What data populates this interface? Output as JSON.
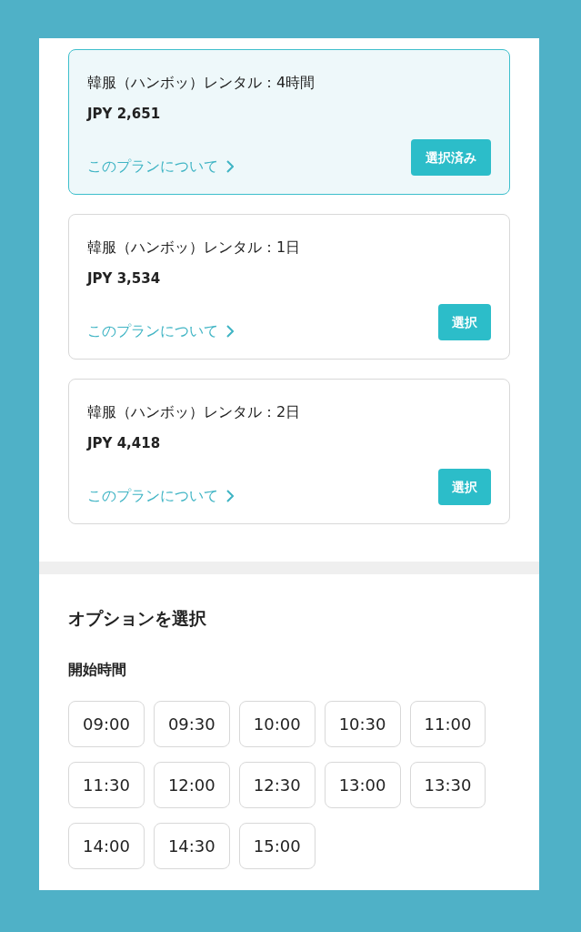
{
  "plans": [
    {
      "title": "韓服（ハンボッ）レンタル：4時間",
      "price": "JPY 2,651",
      "link": "このプランについて",
      "button": "選択済み",
      "selected": true
    },
    {
      "title": "韓服（ハンボッ）レンタル：1日",
      "price": "JPY 3,534",
      "link": "このプランについて",
      "button": "選択",
      "selected": false
    },
    {
      "title": "韓服（ハンボッ）レンタル：2日",
      "price": "JPY 4,418",
      "link": "このプランについて",
      "button": "選択",
      "selected": false
    }
  ],
  "options": {
    "title": "オプションを選択",
    "start_time": {
      "label": "開始時間",
      "times": [
        {
          "label": "09:00",
          "selected": false
        },
        {
          "label": "09:30",
          "selected": false
        },
        {
          "label": "10:00",
          "selected": false
        },
        {
          "label": "10:30",
          "selected": false
        },
        {
          "label": "11:00",
          "selected": false
        },
        {
          "label": "11:30",
          "selected": false
        },
        {
          "label": "12:00",
          "selected": false
        },
        {
          "label": "12:30",
          "selected": false
        },
        {
          "label": "13:00",
          "selected": false
        },
        {
          "label": "13:30",
          "selected": false
        },
        {
          "label": "14:00",
          "selected": false
        },
        {
          "label": "14:30",
          "selected": false
        },
        {
          "label": "15:00",
          "selected": false
        }
      ]
    }
  }
}
